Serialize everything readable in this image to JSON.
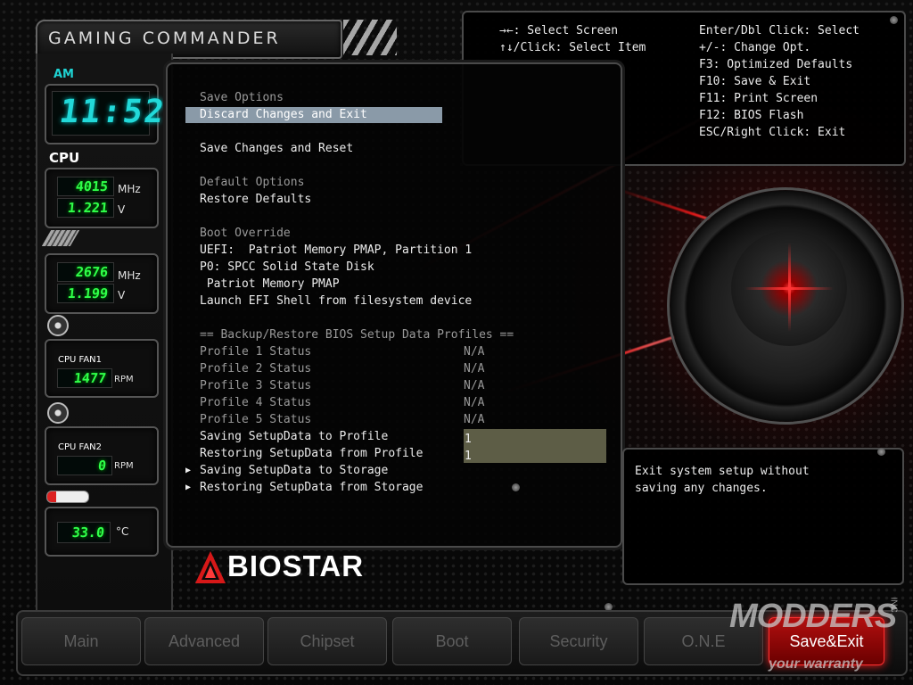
{
  "header": {
    "brand": "GAMING COMMANDER"
  },
  "sensors": {
    "time_period": "AM",
    "clock": "11:52",
    "cpu_label": "CPU",
    "cpu_freq": "4015",
    "cpu_freq_unit": "MHz",
    "cpu_volt": "1.221",
    "cpu_volt_unit": "V",
    "mem_freq": "2676",
    "mem_freq_unit": "MHz",
    "mem_volt": "1.199",
    "mem_volt_unit": "V",
    "fan1_label": "CPU FAN1",
    "fan1_rpm": "1477",
    "fan1_unit": "RPM",
    "fan2_label": "CPU FAN2",
    "fan2_rpm": "0",
    "fan2_unit": "RPM",
    "temp": "33.0",
    "temp_unit": "°C"
  },
  "menu": {
    "save_options_header": "Save Options",
    "discard_exit": "Discard Changes and Exit",
    "save_reset": "Save Changes and Reset",
    "default_options_header": "Default Options",
    "restore_defaults": "Restore Defaults",
    "boot_override_header": "Boot Override",
    "boot1": "UEFI:  Patriot Memory PMAP, Partition 1",
    "boot2": "P0: SPCC Solid State Disk",
    "boot3": " Patriot Memory PMAP",
    "boot4": "Launch EFI Shell from filesystem device",
    "profiles_header": "== Backup/Restore BIOS Setup Data Profiles ==",
    "profiles": [
      {
        "label": "Profile 1 Status",
        "value": "N/A"
      },
      {
        "label": "Profile 2 Status",
        "value": "N/A"
      },
      {
        "label": "Profile 3 Status",
        "value": "N/A"
      },
      {
        "label": "Profile 4 Status",
        "value": "N/A"
      },
      {
        "label": "Profile 5 Status",
        "value": "N/A"
      }
    ],
    "saving_profile": "Saving SetupData to Profile",
    "saving_profile_value": "1",
    "restoring_profile": "Restoring SetupData from Profile",
    "restoring_profile_value": "1",
    "saving_storage": "Saving SetupData to Storage",
    "restoring_storage": "Restoring SetupData from Storage"
  },
  "help": {
    "left": [
      "→←: Select Screen",
      "↑↓/Click: Select Item"
    ],
    "right": [
      "Enter/Dbl Click: Select",
      "+/-: Change Opt.",
      "F3: Optimized Defaults",
      "F10: Save & Exit",
      "F11: Print Screen",
      "F12: BIOS Flash",
      "ESC/Right Click: Exit"
    ]
  },
  "description": {
    "line1": "Exit system setup without",
    "line2": "saving any changes."
  },
  "logo": {
    "text": "BIOSTAR"
  },
  "tabs": [
    {
      "label": "Main"
    },
    {
      "label": "Advanced"
    },
    {
      "label": "Chipset"
    },
    {
      "label": "Boot"
    },
    {
      "label": "Security"
    },
    {
      "label": "O.N.E"
    },
    {
      "label": "Save&Exit"
    }
  ],
  "watermark": {
    "main": "MODDERS",
    "inc": "INC.",
    "sub": "your warranty"
  },
  "colors": {
    "accent_red": "#ff2020",
    "selection_bar": "#8a9aa8",
    "value_box": "#5d5d46",
    "lcd_green": "#2fff4a",
    "lcd_cyan": "#22d9d9"
  }
}
